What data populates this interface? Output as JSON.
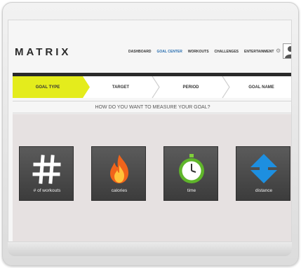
{
  "brand": {
    "logo": "MATRIX"
  },
  "nav": {
    "items": [
      "DASHBOARD",
      "GOAL CENTER",
      "WORKOUTS",
      "CHALLENGES",
      "ENTERTAINMENT"
    ],
    "active": "GOAL CENTER"
  },
  "steps": [
    "GOAL TYPE",
    "TARGET",
    "PERIOD",
    "GOAL NAME"
  ],
  "question": "HOW DO YOU WANT TO MEASURE YOUR GOAL?",
  "options": [
    {
      "label": "# of workouts",
      "icon": "hash-icon"
    },
    {
      "label": "calories",
      "icon": "flame-icon"
    },
    {
      "label": "time",
      "icon": "stopwatch-icon"
    },
    {
      "label": "distance",
      "icon": "up-down-arrows-icon"
    }
  ],
  "colors": {
    "active_step": "#e4ec1c",
    "nav_active": "#2a6fb0",
    "tile_bg": "#4a4a4a"
  }
}
